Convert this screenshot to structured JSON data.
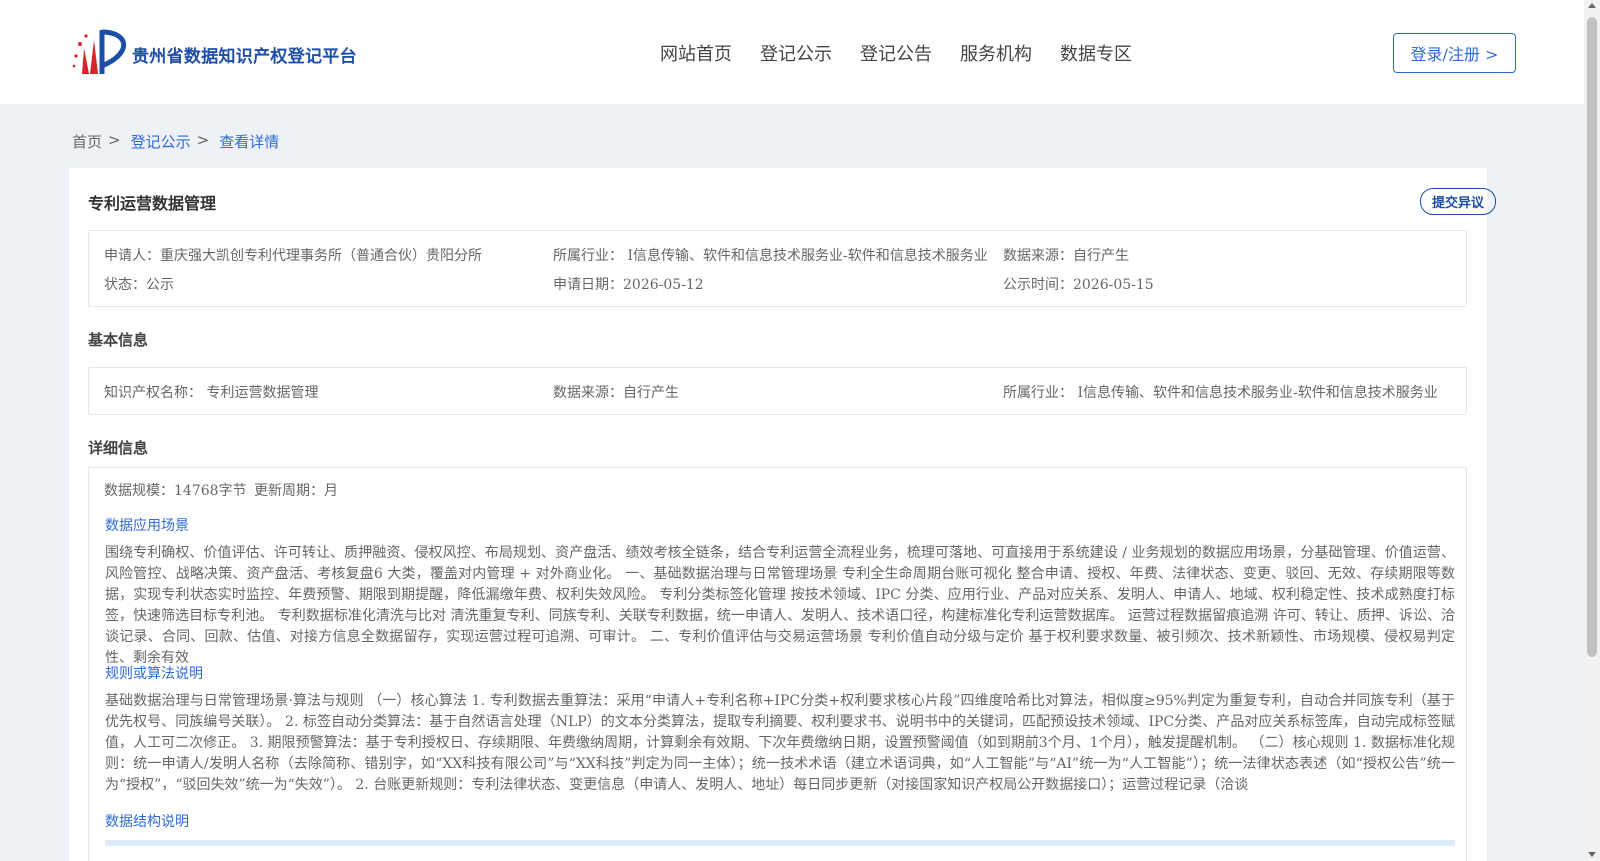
{
  "header": {
    "logo_text": "贵州省数据知识产权登记平台",
    "nav": [
      "网站首页",
      "登记公示",
      "登记公告",
      "服务机构",
      "数据专区"
    ],
    "login_label": "登录/注册 >"
  },
  "breadcrumb": {
    "items": [
      "首页",
      "登记公示",
      "查看详情"
    ],
    "sep": ">"
  },
  "detail": {
    "title": "专利运营数据管理",
    "objection_label": "提交异议",
    "summary": {
      "applicant": "申请人：重庆强大凯创专利代理事务所（普通合伙）贵阳分所",
      "industry": "所属行业： I信息传输、软件和信息技术服务业-软件和信息技术服务业",
      "source": "数据来源：自行产生",
      "status": "状态：公示",
      "apply_date": "申请日期：2026-05-12",
      "publish_date": "公示时间：2026-05-15"
    },
    "basic_title": "基本信息",
    "basic": {
      "ip_name": "知识产权名称： 专利运营数据管理",
      "source": "数据来源：自行产生",
      "industry": "所属行业： I信息传输、软件和信息技术服务业-软件和信息技术服务业"
    },
    "detail_title": "详细信息",
    "detail_meta": {
      "scale": "数据规模：14768字节",
      "cycle": "更新周期：月"
    },
    "scenario_title": "数据应用场景",
    "scenario_text": "围绕专利确权、价值评估、许可转让、质押融资、侵权风控、布局规划、资产盘活、绩效考核全链条，结合专利运营全流程业务，梳理可落地、可直接用于系统建设 / 业务规划的数据应用场景，分基础管理、价值运营、风险管控、战略决策、资产盘活、考核复盘6 大类，覆盖对内管理 + 对外商业化。 一、基础数据治理与日常管理场景 专利全生命周期台账可视化 整合申请、授权、年费、法律状态、变更、驳回、无效、存续期限等数据，实现专利状态实时监控、年费预警、期限到期提醒，降低漏缴年费、权利失效风险。 专利分类标签化管理 按技术领域、IPC 分类、应用行业、产品对应关系、发明人、申请人、地域、权利稳定性、技术成熟度打标签，快速筛选目标专利池。 专利数据标准化清洗与比对 清洗重复专利、同族专利、关联专利数据，统一申请人、发明人、技术语口径，构建标准化专利运营数据库。 运营过程数据留痕追溯 许可、转让、质押、诉讼、洽谈记录、合同、回款、估值、对接方信息全数据留存，实现运营过程可追溯、可审计。 二、专利价值评估与交易运营场景 专利价值自动分级与定价 基于权利要求数量、被引频次、技术新颖性、市场规模、侵权易判定性、剩余有效",
    "rules_title": "规则或算法说明",
    "rules_text": "基础数据治理与日常管理场景·算法与规则 （一）核心算法 1. 专利数据去重算法：采用“申请人+专利名称+IPC分类+权利要求核心片段”四维度哈希比对算法，相似度≥95%判定为重复专利，自动合并同族专利（基于优先权号、同族编号关联）。 2. 标签自动分类算法：基于自然语言处理（NLP）的文本分类算法，提取专利摘要、权利要求书、说明书中的关键词，匹配预设技术领域、IPC分类、产品对应关系标签库，自动完成标签赋值，人工可二次修正。 3. 期限预警算法：基于专利授权日、存续期限、年费缴纳周期，计算剩余有效期、下次年费缴纳日期，设置预警阈值（如到期前3个月、1个月），触发提醒机制。 （二）核心规则 1. 数据标准化规则：统一申请人/发明人名称（去除简称、错别字，如“XX科技有限公司”与“XX科技”判定为同一主体）；统一技术术语（建立术语词典，如“人工智能”与“AI”统一为“人工智能”）；统一法律状态表述（如“授权公告”统一为“授权”，“驳回失效”统一为“失效”）。 2. 台账更新规则：专利法律状态、变更信息（申请人、发明人、地址）每日同步更新（对接国家知识产权局公开数据接口）；运营过程记录（洽谈",
    "structure_title": "数据结构说明"
  },
  "colors": {
    "brand": "#1d4fa8",
    "link": "#2f6bd8",
    "page_bg": "#eef1f5"
  }
}
